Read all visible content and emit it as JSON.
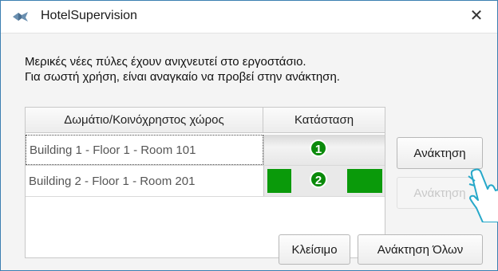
{
  "window": {
    "title": "HotelSupervision",
    "close_symbol": "✕",
    "icons": [
      "app-icon",
      "close-icon",
      "pointing-hand-icon"
    ]
  },
  "message": {
    "line1": "Μερικές νέες πύλες έχουν ανιχνευτεί στο εργοστάσιο.",
    "line2": "Για σωστή χρήση, είναι αναγκαίο να προβεί στην ανάκτηση."
  },
  "table": {
    "headers": [
      "Δωμάτιο/Κοινόχρηστος χώρος",
      "Κατάσταση"
    ],
    "rows": [
      {
        "room": "Building 1 - Floor 1 - Room 101",
        "badge": "1",
        "recover_label": "Ανάκτηση",
        "recover_enabled": true
      },
      {
        "room": "Building 2 - Floor 1 - Room 201",
        "badge": "2",
        "recover_label": "Ανάκτηση",
        "recover_enabled": false
      }
    ]
  },
  "buttons": {
    "close": "Κλείσιμο",
    "recover_all": "Ανάκτηση Όλων"
  },
  "colors": {
    "status_green": "#0a9a0a",
    "badge_green": "#0a8a0a",
    "window_border": "#3c7fb1"
  }
}
